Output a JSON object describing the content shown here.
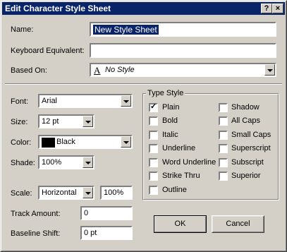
{
  "window": {
    "title": "Edit Character Style Sheet",
    "help_icon": "?",
    "close_icon": "×"
  },
  "name": {
    "label": "Name:",
    "value": "New Style Sheet"
  },
  "keyboard": {
    "label": "Keyboard Equivalent:",
    "value": ""
  },
  "based_on": {
    "label": "Based On:",
    "icon": "A",
    "value": "No Style"
  },
  "font": {
    "label": "Font:",
    "value": "Arial"
  },
  "size": {
    "label": "Size:",
    "value": "12 pt"
  },
  "color": {
    "label": "Color:",
    "value": "Black",
    "swatch": "#000000"
  },
  "shade": {
    "label": "Shade:",
    "value": "100%"
  },
  "scale": {
    "label": "Scale:",
    "value": "Horizontal",
    "percent": "100%"
  },
  "track": {
    "label": "Track Amount:",
    "value": "0"
  },
  "baseline": {
    "label": "Baseline Shift:",
    "value": "0 pt"
  },
  "type_style": {
    "title": "Type Style",
    "left": [
      {
        "label": "Plain",
        "checked": true
      },
      {
        "label": "Bold",
        "checked": false
      },
      {
        "label": "Italic",
        "checked": false
      },
      {
        "label": "Underline",
        "checked": false
      },
      {
        "label": "Word Underline",
        "checked": false
      },
      {
        "label": "Strike Thru",
        "checked": false
      },
      {
        "label": "Outline",
        "checked": false
      }
    ],
    "right": [
      {
        "label": "Shadow",
        "checked": false
      },
      {
        "label": "All Caps",
        "checked": false
      },
      {
        "label": "Small Caps",
        "checked": false
      },
      {
        "label": "Superscript",
        "checked": false
      },
      {
        "label": "Subscript",
        "checked": false
      },
      {
        "label": "Superior",
        "checked": false
      }
    ]
  },
  "buttons": {
    "ok": "OK",
    "cancel": "Cancel"
  }
}
